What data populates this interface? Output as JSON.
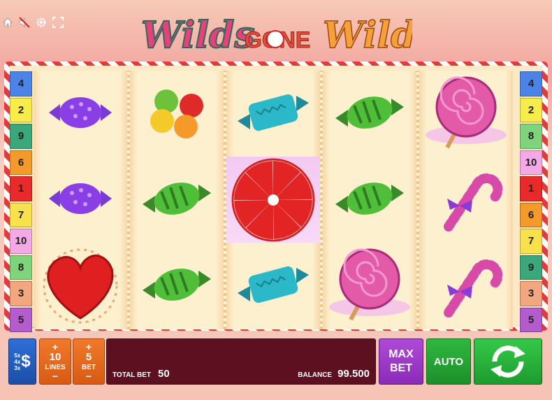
{
  "logo": {
    "word1": "Wilds",
    "word2": "GONE",
    "word3": "Wild"
  },
  "left_numbers": [
    "4",
    "2",
    "9",
    "6",
    "1",
    "7",
    "10",
    "8",
    "3",
    "5"
  ],
  "right_numbers": [
    "4",
    "2",
    "8",
    "10",
    "1",
    "6",
    "7",
    "9",
    "3",
    "5"
  ],
  "number_colors": {
    "1": "#e82a2a",
    "2": "#f6ec4a",
    "3": "#f2a77e",
    "4": "#4b83e6",
    "5": "#b45ccd",
    "6": "#f39a2b",
    "7": "#f8e14d",
    "8": "#7fd37a",
    "9": "#3aa87a",
    "10": "#f4a9e6"
  },
  "reels": [
    [
      "purple-candy-icon",
      "purple-candy-icon",
      "red-heart-candy-icon"
    ],
    [
      "gumballs-icon",
      "green-candy-icon",
      "green-candy-icon"
    ],
    [
      "teal-candy-icon",
      "peppermint-wild-icon",
      "teal-candy-icon"
    ],
    [
      "green-candy-icon",
      "green-candy-icon",
      "pink-lollipop-icon"
    ],
    [
      "pink-lollipop-icon",
      "candy-cane-icon",
      "candy-cane-icon"
    ]
  ],
  "panel": {
    "ways_lines": [
      "5x",
      "4x",
      "3x"
    ],
    "currency": "$",
    "lines": {
      "plus": "+",
      "value": "10",
      "label": "LINES",
      "minus": "−"
    },
    "bet": {
      "plus": "+",
      "value": "5",
      "label": "BET",
      "minus": "−"
    },
    "total_bet_label": "TOTAL BET",
    "total_bet_value": "50",
    "balance_label": "BALANCE",
    "balance_value": "99.500",
    "max_bet_1": "MAX",
    "max_bet_2": "BET",
    "auto_label": "AUTO"
  }
}
